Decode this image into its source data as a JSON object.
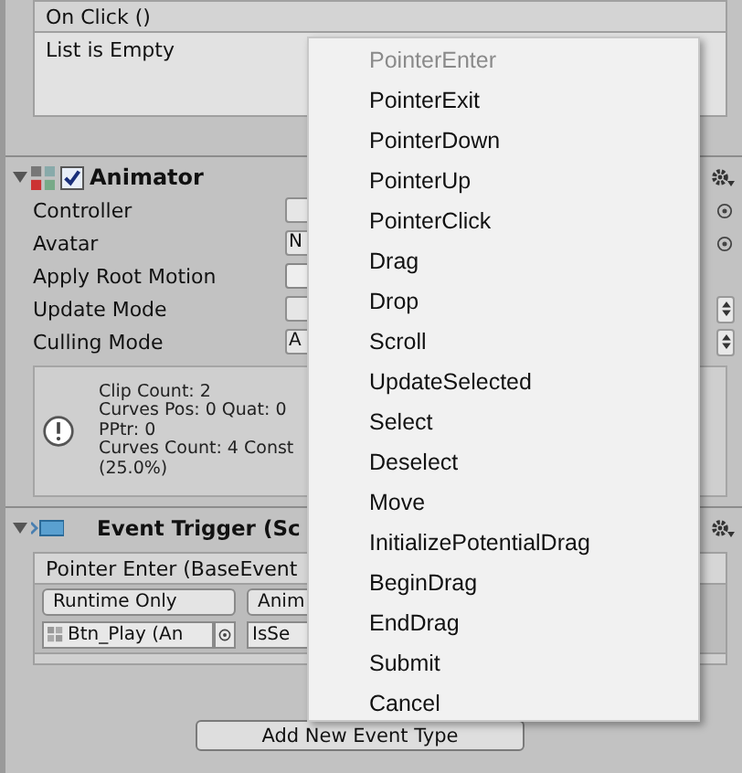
{
  "on_click": {
    "title": "On Click ()",
    "list_text": "List is Empty"
  },
  "animator": {
    "title": "Animator",
    "enabled": true,
    "expanded": true,
    "fields": [
      {
        "label": "Controller",
        "kind": "object"
      },
      {
        "label": "Avatar",
        "kind": "object",
        "value": "N"
      },
      {
        "label": "Apply Root Motion",
        "kind": "checkbox",
        "checked": false
      },
      {
        "label": "Update Mode",
        "kind": "dropdown"
      },
      {
        "label": "Culling Mode",
        "kind": "dropdown",
        "value": "A"
      }
    ],
    "info_lines": [
      "Clip Count: 2",
      "Curves Pos: 0 Quat: 0",
      "PPtr: 0",
      "Curves Count: 4 Const",
      "(25.0%)"
    ]
  },
  "event_trigger": {
    "title": "Event Trigger (Sc",
    "expanded": true,
    "entry_title": "Pointer Enter (BaseEvent",
    "runtime": "Runtime Only",
    "function": "Anim",
    "target": "Btn_Play (An",
    "argument": "IsSe",
    "add_button": "Add New Event Type"
  },
  "menu": {
    "items": [
      {
        "label": "PointerEnter",
        "disabled": true
      },
      {
        "label": "PointerExit",
        "disabled": false
      },
      {
        "label": "PointerDown",
        "disabled": false
      },
      {
        "label": "PointerUp",
        "disabled": false
      },
      {
        "label": "PointerClick",
        "disabled": false
      },
      {
        "label": "Drag",
        "disabled": false
      },
      {
        "label": "Drop",
        "disabled": false
      },
      {
        "label": "Scroll",
        "disabled": false
      },
      {
        "label": "UpdateSelected",
        "disabled": false
      },
      {
        "label": "Select",
        "disabled": false
      },
      {
        "label": "Deselect",
        "disabled": false
      },
      {
        "label": "Move",
        "disabled": false
      },
      {
        "label": "InitializePotentialDrag",
        "disabled": false
      },
      {
        "label": "BeginDrag",
        "disabled": false
      },
      {
        "label": "EndDrag",
        "disabled": false
      },
      {
        "label": "Submit",
        "disabled": false
      },
      {
        "label": "Cancel",
        "disabled": false
      }
    ]
  }
}
